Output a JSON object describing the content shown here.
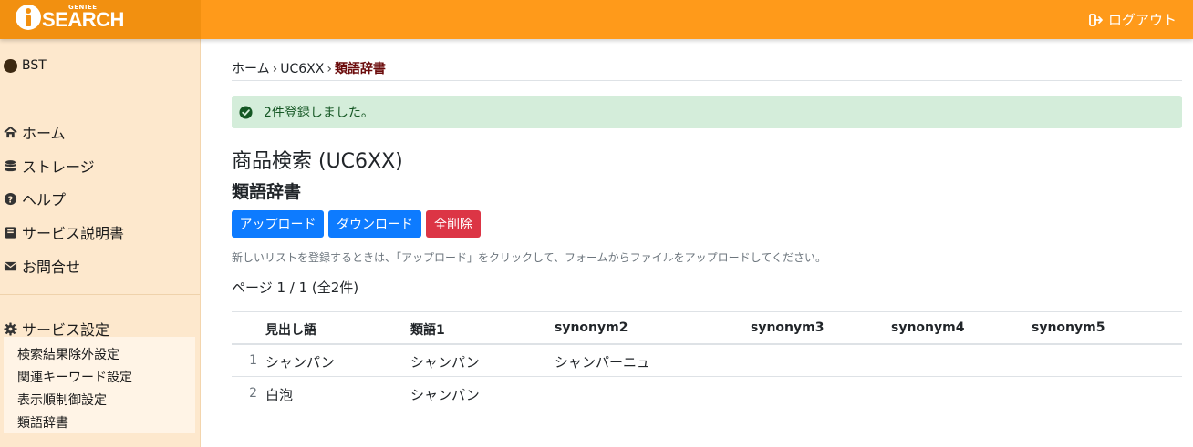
{
  "header": {
    "brand_small": "GENIEE",
    "brand_main": "SEARCH",
    "logout_label": "ログアウト",
    "colors": {
      "bar": "#ff9a1a",
      "brand_bg": "#f29010"
    }
  },
  "sidebar": {
    "account": "BST",
    "nav": [
      {
        "label": "ホーム",
        "icon": "home-icon"
      },
      {
        "label": "ストレージ",
        "icon": "database-icon"
      },
      {
        "label": "ヘルプ",
        "icon": "question-circle-icon"
      },
      {
        "label": "サービス説明書",
        "icon": "book-icon"
      },
      {
        "label": "お問合せ",
        "icon": "envelope-icon"
      }
    ],
    "settings_label": "サービス設定",
    "settings_items": [
      "検索結果除外設定",
      "関連キーワード設定",
      "表示順制御設定",
      "類語辞書"
    ]
  },
  "breadcrumb": {
    "home": "ホーム",
    "service": "UC6XX",
    "current": "類語辞書"
  },
  "alert": {
    "message": "2件登録しました。"
  },
  "page": {
    "title": "商品検索 (UC6XX)",
    "subtitle": "類語辞書"
  },
  "actions": {
    "upload": "アップロード",
    "download": "ダウンロード",
    "delete_all": "全削除"
  },
  "hint": "新しいリストを登録するときは、「アップロード」をクリックして、フォームからファイルをアップロードしてください。",
  "pager": "ページ 1 / 1 (全2件)",
  "table": {
    "headers": [
      "見出し語",
      "類語1",
      "synonym2",
      "synonym3",
      "synonym4",
      "synonym5"
    ],
    "rows": [
      {
        "num": "1",
        "cells": [
          "シャンパン",
          "シャンパン",
          "シャンパーニュ",
          "",
          "",
          ""
        ]
      },
      {
        "num": "2",
        "cells": [
          "白泡",
          "シャンパン",
          "",
          "",
          "",
          ""
        ]
      }
    ]
  }
}
